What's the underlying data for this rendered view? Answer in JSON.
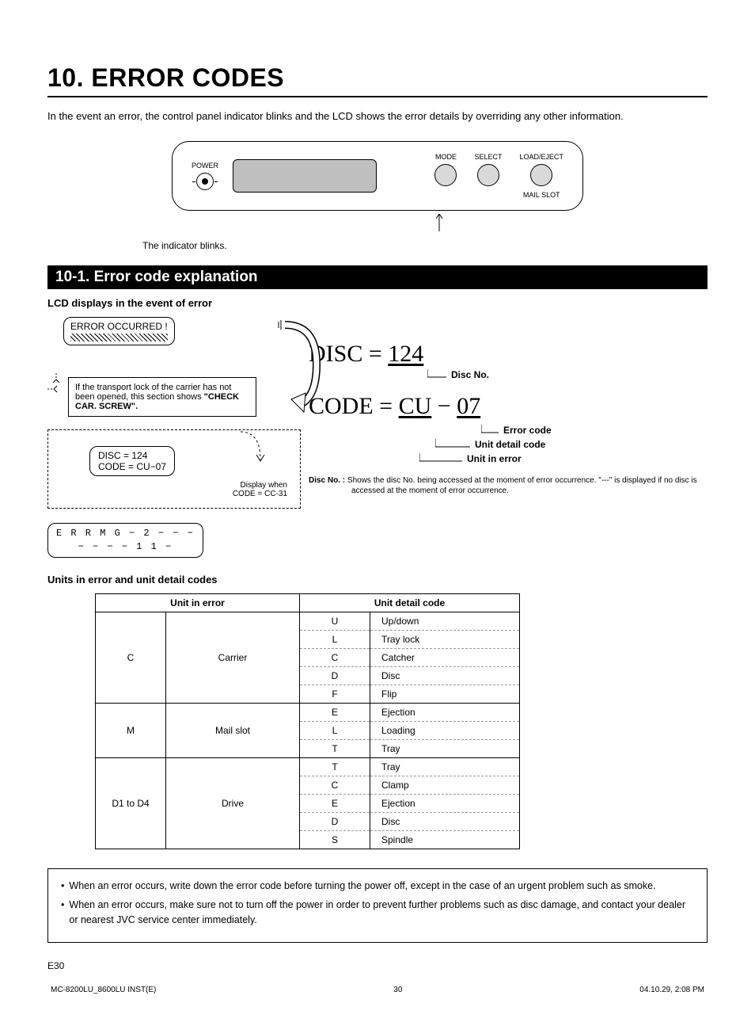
{
  "chapter_title": "10. ERROR CODES",
  "intro": "In the event an error, the control panel indicator blinks and the LCD shows the error details by overriding any other information.",
  "panel": {
    "power_label": "POWER",
    "buttons": [
      {
        "top": "MODE",
        "bottom": ""
      },
      {
        "top": "SELECT",
        "bottom": ""
      },
      {
        "top": "LOAD/EJECT",
        "bottom": "MAIL SLOT"
      }
    ]
  },
  "indicator_text": "The indicator blinks.",
  "section_title": "10-1. Error code explanation",
  "lcd_heading": "LCD displays in the event of error",
  "lcd1": "ERROR  OCCURRED !",
  "info_box": "If the transport lock of the carrier has not been opened, this section shows \"CHECK CAR. SCREW\".",
  "info_box_bold": "\"CHECK CAR. SCREW\".",
  "lcd2_line1": "DISC = 124",
  "lcd2_line2": "CODE = CU−07",
  "display_note_1": "Display when",
  "display_note_2": "CODE = CC-31",
  "err_line1": "E R R  M G  −  2  −  −  −",
  "err_line2": "−  −  −  −  1 1  −",
  "big_disc_label": "DISC = ",
  "big_disc_val": "124",
  "big_code_label": "CODE = ",
  "big_code_unit": "C",
  "big_code_detail": "U",
  "big_code_dash": " − ",
  "big_code_err": "07",
  "annot_disc_no": "Disc No.",
  "annot_err_code": "Error code",
  "annot_unit_detail": "Unit detail code",
  "annot_unit_err": "Unit in error",
  "footnote_label": "Disc No. :",
  "footnote_text": "Shows the disc No. being accessed at the moment of error occurrence. \"---\" is displayed if no disc is accessed at the moment of error occurrence.",
  "table_heading": "Units in error and unit detail codes",
  "table": {
    "head_unit": "Unit in error",
    "head_detail": "Unit detail code",
    "groups": [
      {
        "code": "C",
        "name": "Carrier",
        "details": [
          {
            "c": "U",
            "n": "Up/down"
          },
          {
            "c": "L",
            "n": "Tray lock"
          },
          {
            "c": "C",
            "n": "Catcher"
          },
          {
            "c": "D",
            "n": "Disc"
          },
          {
            "c": "F",
            "n": "Flip"
          }
        ]
      },
      {
        "code": "M",
        "name": "Mail slot",
        "details": [
          {
            "c": "E",
            "n": "Ejection"
          },
          {
            "c": "L",
            "n": "Loading"
          },
          {
            "c": "T",
            "n": "Tray"
          }
        ]
      },
      {
        "code": "D1 to D4",
        "name": "Drive",
        "details": [
          {
            "c": "T",
            "n": "Tray"
          },
          {
            "c": "C",
            "n": "Clamp"
          },
          {
            "c": "E",
            "n": "Ejection"
          },
          {
            "c": "D",
            "n": "Disc"
          },
          {
            "c": "S",
            "n": "Spindle"
          }
        ]
      }
    ]
  },
  "notes": [
    "When an error occurs, write down the error code before turning the power off, except in the case of an urgent problem such as smoke.",
    "When an error occurs, make sure not to turn off the power in order to prevent further problems such as disc damage, and contact your dealer or nearest JVC service center immediately."
  ],
  "page_num": "E30",
  "footer_left": "MC-8200LU_8600LU INST(E)",
  "footer_center": "30",
  "footer_right": "04.10.29, 2:08 PM"
}
